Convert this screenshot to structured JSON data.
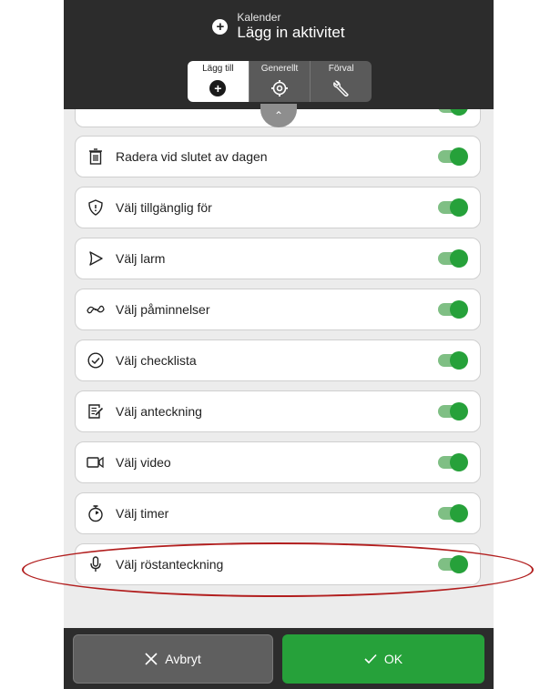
{
  "header": {
    "subtitle": "Kalender",
    "title": "Lägg in aktivitet"
  },
  "tabs": [
    {
      "label": "Lägg till",
      "icon": "plus-circle-icon",
      "active": true
    },
    {
      "label": "Generellt",
      "icon": "gear-icon",
      "active": false
    },
    {
      "label": "Förval",
      "icon": "wrench-icon",
      "active": false
    }
  ],
  "settings": [
    {
      "label": "Radera vid slutet av dagen",
      "icon": "trash-icon",
      "enabled": true
    },
    {
      "label": "Välj tillgänglig för",
      "icon": "shield-icon",
      "enabled": true
    },
    {
      "label": "Välj larm",
      "icon": "bell-icon",
      "enabled": true
    },
    {
      "label": "Välj påminnelser",
      "icon": "reminder-icon",
      "enabled": true
    },
    {
      "label": "Välj checklista",
      "icon": "check-circle-icon",
      "enabled": true
    },
    {
      "label": "Välj anteckning",
      "icon": "note-icon",
      "enabled": true
    },
    {
      "label": "Välj video",
      "icon": "video-icon",
      "enabled": true
    },
    {
      "label": "Välj timer",
      "icon": "timer-icon",
      "enabled": true
    },
    {
      "label": "Välj röstanteckning",
      "icon": "microphone-icon",
      "enabled": true
    }
  ],
  "footer": {
    "cancel_label": "Avbryt",
    "ok_label": "OK"
  },
  "colors": {
    "header_bg": "#2c2c2c",
    "toggle_on": "#26a13a",
    "ok_button": "#26a13a",
    "highlight": "#b21f1f"
  }
}
